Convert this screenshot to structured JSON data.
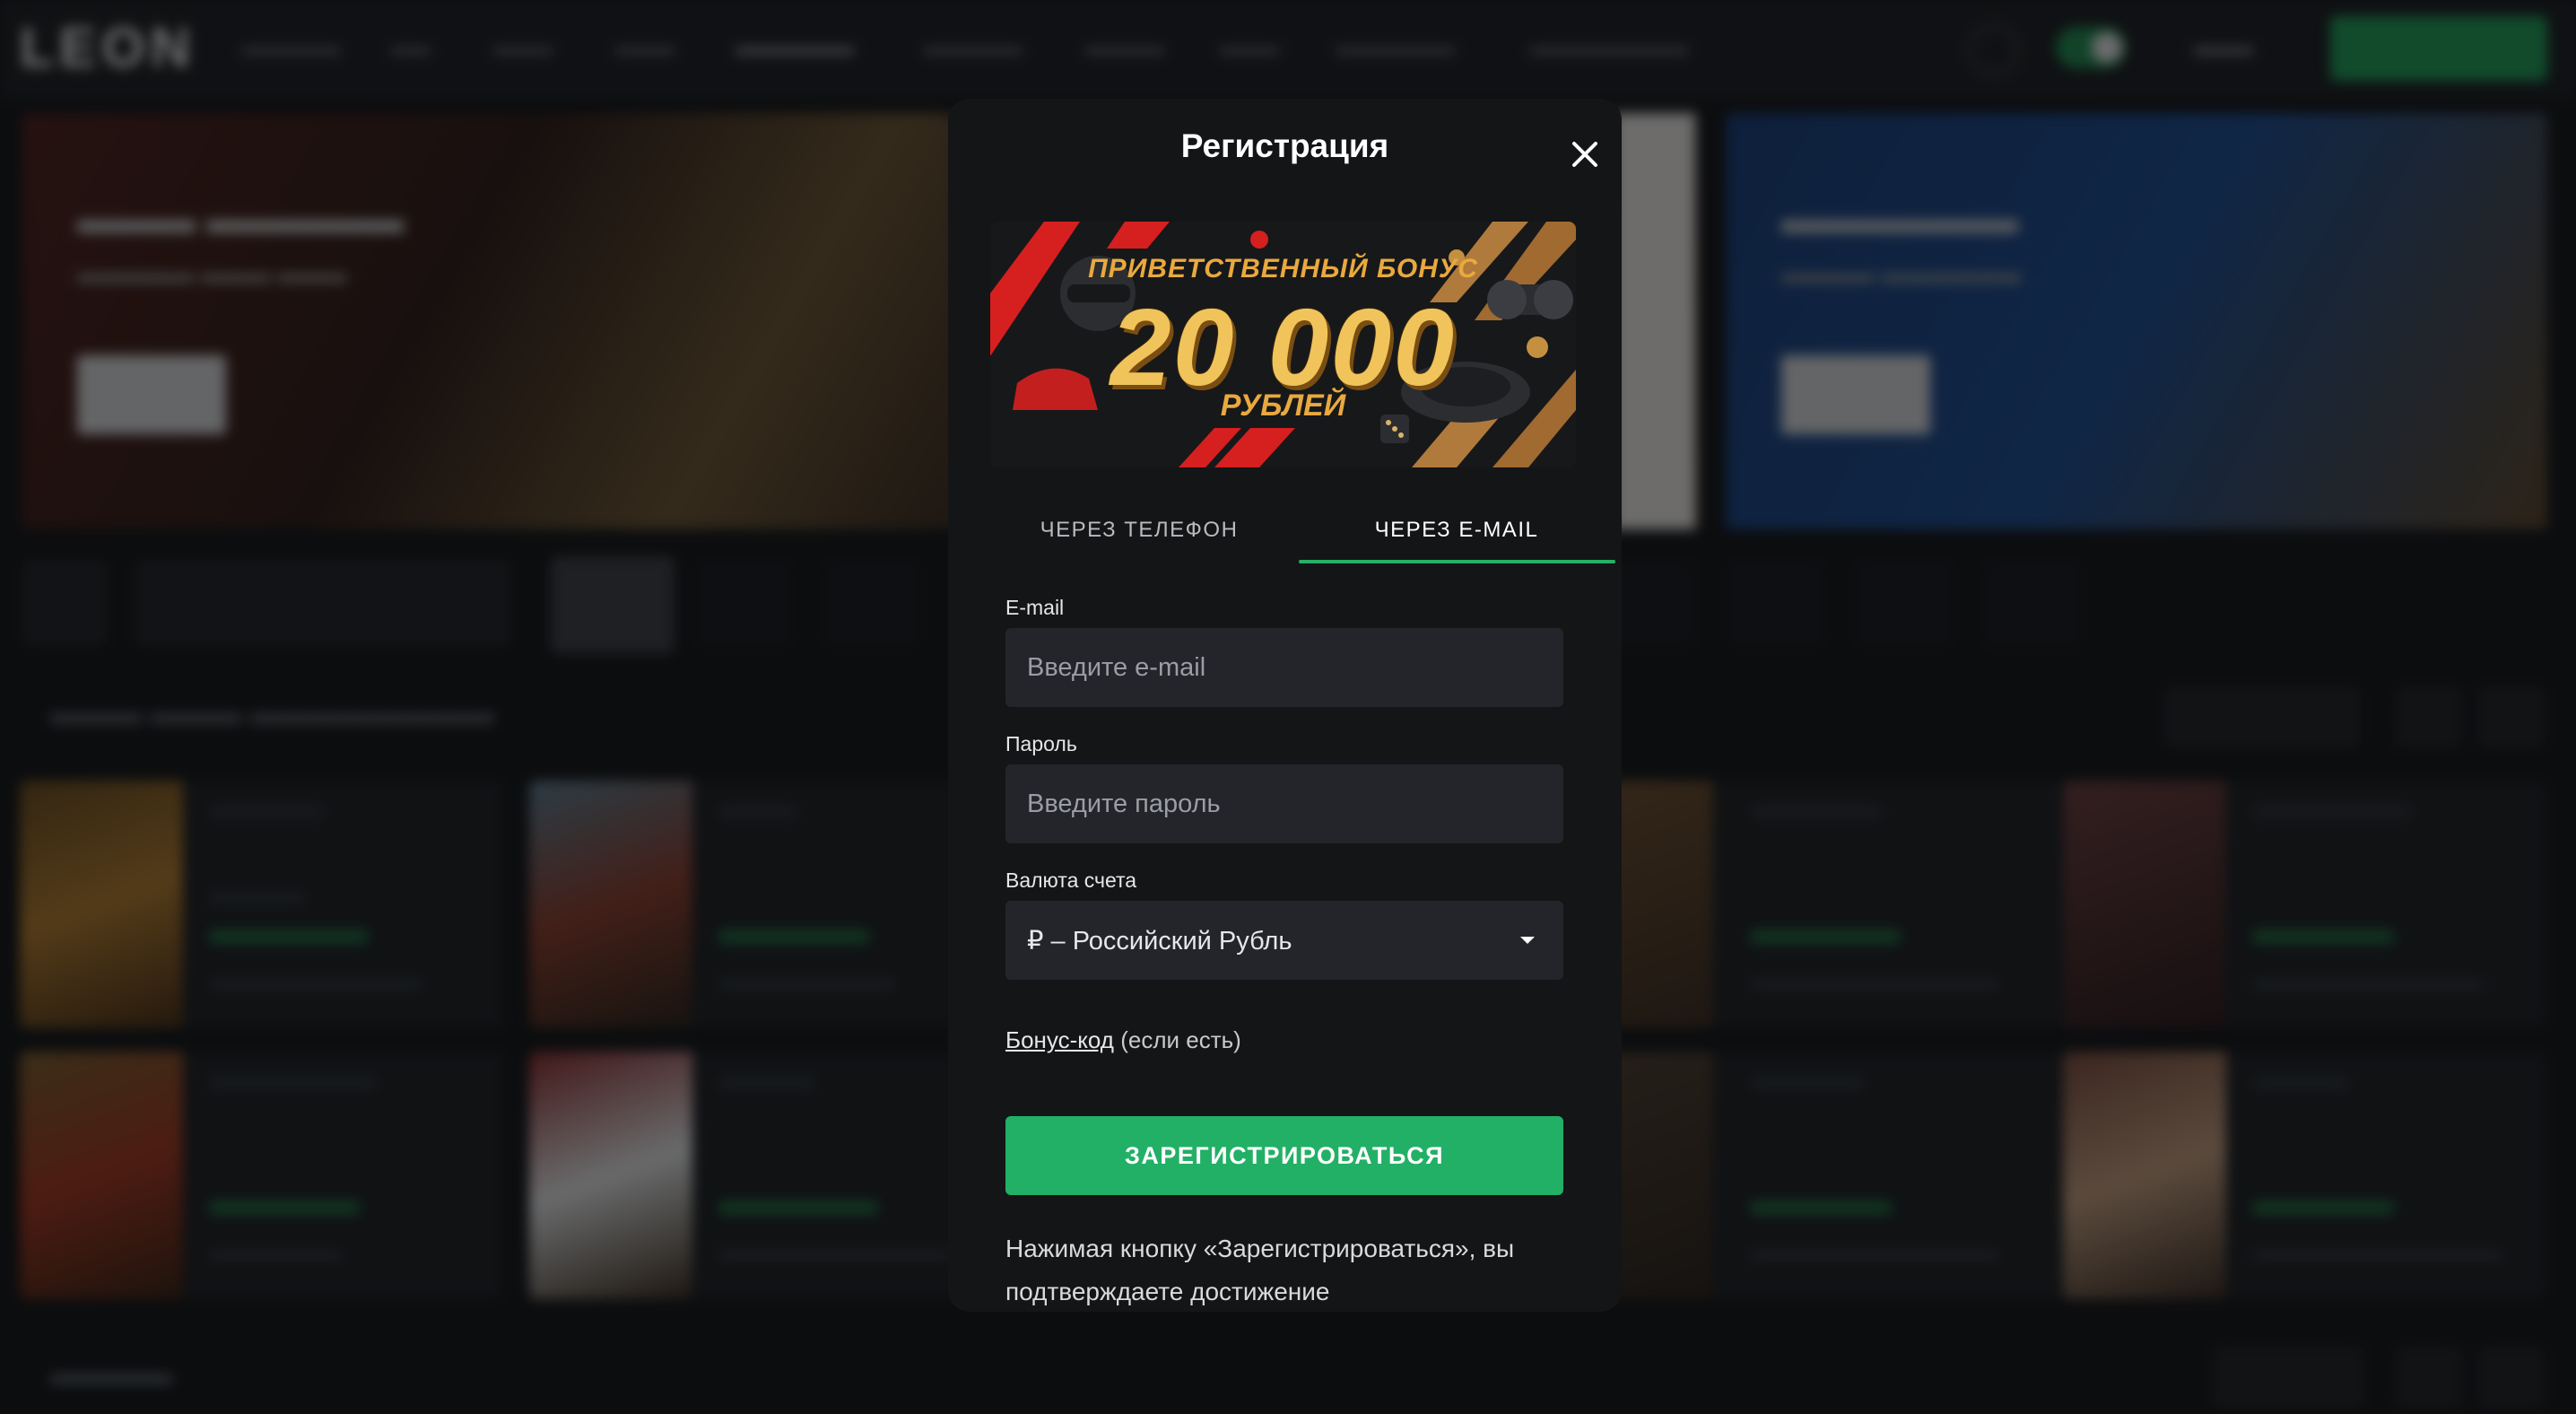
{
  "modal": {
    "title": "Регистрация",
    "close_icon": "close-icon",
    "promo": {
      "line1": "ПРИВЕТСТВЕННЫЙ БОНУС",
      "amount": "20 000",
      "line3": "РУБЛЕЙ"
    },
    "tabs": [
      {
        "label": "ЧЕРЕЗ ТЕЛЕФОН",
        "active": false
      },
      {
        "label": "ЧЕРЕЗ E-MAIL",
        "active": true
      }
    ],
    "fields": {
      "email": {
        "label": "E-mail",
        "placeholder": "Введите e-mail",
        "value": ""
      },
      "password": {
        "label": "Пароль",
        "placeholder": "Введите пароль",
        "value": ""
      },
      "currency": {
        "label": "Валюта счета",
        "value": "₽ – Российский Рубль"
      }
    },
    "bonus": {
      "link": "Бонус-код",
      "suffix": " (если есть)"
    },
    "submit_label": "ЗАРЕГИСТРИРОВАТЬСЯ",
    "terms": "Нажимая кнопку «Зарегистрироваться», вы подтверждаете достижение"
  },
  "colors": {
    "accent_green": "#22b066",
    "modal_bg": "#141517",
    "input_bg": "#23252a",
    "promo_gold": "#f0c45a",
    "promo_red": "#d61f1f"
  }
}
